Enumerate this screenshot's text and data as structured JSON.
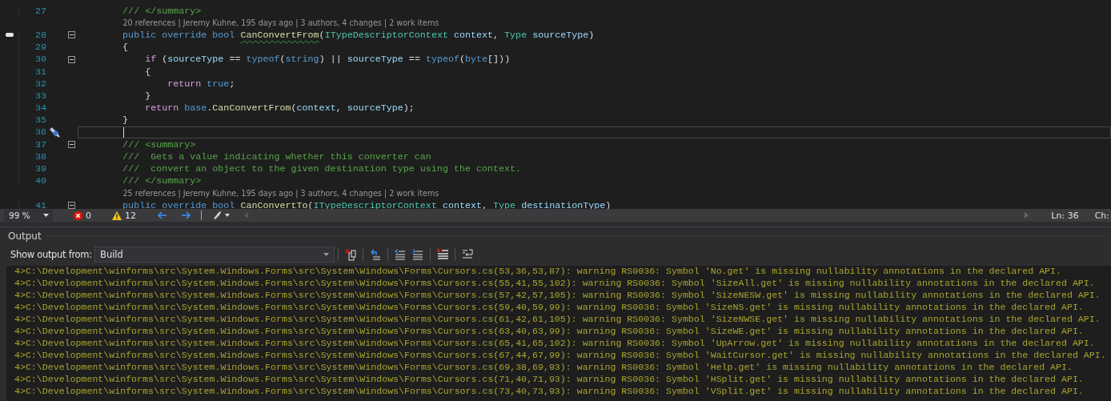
{
  "editor": {
    "lines": [
      {
        "kind": "code",
        "number": "27",
        "fold": false,
        "marker": false,
        "current": false,
        "tokens": [
          {
            "kind": "comment",
            "text": "        /// </summary>"
          }
        ]
      },
      {
        "kind": "lens",
        "text": "20 references | Jeremy Kuhne, 195 days ago | 3 authors, 4 changes | 2 work items"
      },
      {
        "kind": "code",
        "number": "28",
        "fold": true,
        "marker": true,
        "current": false,
        "tokens": [
          {
            "kind": "keyword",
            "text": "        public override bool "
          },
          {
            "kind": "method",
            "text": "CanConvertFrom",
            "squiggle": true
          },
          {
            "kind": "plain",
            "text": "("
          },
          {
            "kind": "type",
            "text": "ITypeDescriptorContext "
          },
          {
            "kind": "param",
            "text": "context"
          },
          {
            "kind": "plain",
            "text": ", "
          },
          {
            "kind": "type",
            "text": "Type "
          },
          {
            "kind": "param",
            "text": "sourceType"
          },
          {
            "kind": "plain",
            "text": ")"
          }
        ]
      },
      {
        "kind": "code",
        "number": "29",
        "fold": false,
        "marker": false,
        "current": false,
        "tokens": [
          {
            "kind": "plain",
            "text": "        {"
          }
        ]
      },
      {
        "kind": "code",
        "number": "30",
        "fold": true,
        "marker": false,
        "current": false,
        "tokens": [
          {
            "kind": "control",
            "text": "            if"
          },
          {
            "kind": "plain",
            "text": " ("
          },
          {
            "kind": "param",
            "text": "sourceType"
          },
          {
            "kind": "plain",
            "text": " == "
          },
          {
            "kind": "keyword",
            "text": "typeof"
          },
          {
            "kind": "plain",
            "text": "("
          },
          {
            "kind": "keyword",
            "text": "string"
          },
          {
            "kind": "plain",
            "text": ") || "
          },
          {
            "kind": "param",
            "text": "sourceType"
          },
          {
            "kind": "plain",
            "text": " == "
          },
          {
            "kind": "keyword",
            "text": "typeof"
          },
          {
            "kind": "plain",
            "text": "("
          },
          {
            "kind": "keyword",
            "text": "byte"
          },
          {
            "kind": "plain",
            "text": "[]))"
          }
        ]
      },
      {
        "kind": "code",
        "number": "31",
        "fold": false,
        "marker": false,
        "current": false,
        "tokens": [
          {
            "kind": "plain",
            "text": "            {"
          }
        ]
      },
      {
        "kind": "code",
        "number": "32",
        "fold": false,
        "marker": false,
        "current": false,
        "tokens": [
          {
            "kind": "control",
            "text": "                return "
          },
          {
            "kind": "keyword",
            "text": "true"
          },
          {
            "kind": "plain",
            "text": ";"
          }
        ]
      },
      {
        "kind": "code",
        "number": "33",
        "fold": false,
        "marker": false,
        "current": false,
        "tokens": [
          {
            "kind": "plain",
            "text": "            }"
          }
        ]
      },
      {
        "kind": "code",
        "number": "34",
        "fold": false,
        "marker": false,
        "current": false,
        "tokens": [
          {
            "kind": "control",
            "text": "            return "
          },
          {
            "kind": "keyword",
            "text": "base"
          },
          {
            "kind": "plain",
            "text": "."
          },
          {
            "kind": "method",
            "text": "CanConvertFrom"
          },
          {
            "kind": "plain",
            "text": "("
          },
          {
            "kind": "param",
            "text": "context"
          },
          {
            "kind": "plain",
            "text": ", "
          },
          {
            "kind": "param",
            "text": "sourceType"
          },
          {
            "kind": "plain",
            "text": ");"
          }
        ]
      },
      {
        "kind": "code",
        "number": "35",
        "fold": false,
        "marker": false,
        "current": false,
        "tokens": [
          {
            "kind": "plain",
            "text": "        }"
          }
        ]
      },
      {
        "kind": "code",
        "number": "36",
        "fold": false,
        "marker": false,
        "current": true
      },
      {
        "kind": "code",
        "number": "37",
        "fold": true,
        "marker": false,
        "current": false,
        "tokens": [
          {
            "kind": "comment",
            "text": "        /// <summary>"
          }
        ]
      },
      {
        "kind": "code",
        "number": "38",
        "fold": false,
        "marker": false,
        "current": false,
        "tokens": [
          {
            "kind": "comment",
            "text": "        ///  Gets a value indicating whether this converter can"
          }
        ]
      },
      {
        "kind": "code",
        "number": "39",
        "fold": false,
        "marker": false,
        "current": false,
        "tokens": [
          {
            "kind": "comment",
            "text": "        ///  convert an object to the given destination type using the context."
          }
        ]
      },
      {
        "kind": "code",
        "number": "40",
        "fold": false,
        "marker": false,
        "current": false,
        "tokens": [
          {
            "kind": "comment",
            "text": "        /// </summary>"
          }
        ]
      },
      {
        "kind": "lens",
        "text": "25 references | Jeremy Kuhne, 195 days ago | 3 authors, 4 changes | 2 work items"
      },
      {
        "kind": "code",
        "number": "41",
        "fold": true,
        "marker": false,
        "current": false,
        "tokens": [
          {
            "kind": "keyword",
            "text": "        public override bool "
          },
          {
            "kind": "method",
            "text": "CanConvertTo"
          },
          {
            "kind": "plain",
            "text": "("
          },
          {
            "kind": "type",
            "text": "ITypeDescriptorContext "
          },
          {
            "kind": "param",
            "text": "context"
          },
          {
            "kind": "plain",
            "text": ", "
          },
          {
            "kind": "type",
            "text": "Type "
          },
          {
            "kind": "param",
            "text": "destinationType"
          },
          {
            "kind": "plain",
            "text": ")"
          }
        ]
      }
    ]
  },
  "status_bar": {
    "zoom": "99 %",
    "errors": "0",
    "warnings": "12",
    "line": "Ln: 36",
    "column": "Ch:"
  },
  "output": {
    "title": "Output",
    "show_from_label": "Show output from:",
    "source": "Build",
    "lines": [
      "4>C:\\Development\\winforms\\src\\System.Windows.Forms\\src\\System\\Windows\\Forms\\Cursors.cs(53,36,53,87): warning RS0036: Symbol 'No.get' is missing nullability annotations in the declared API.",
      "4>C:\\Development\\winforms\\src\\System.Windows.Forms\\src\\System\\Windows\\Forms\\Cursors.cs(55,41,55,102): warning RS0036: Symbol 'SizeAll.get' is missing nullability annotations in the declared API.",
      "4>C:\\Development\\winforms\\src\\System.Windows.Forms\\src\\System\\Windows\\Forms\\Cursors.cs(57,42,57,105): warning RS0036: Symbol 'SizeNESW.get' is missing nullability annotations in the declared API.",
      "4>C:\\Development\\winforms\\src\\System.Windows.Forms\\src\\System\\Windows\\Forms\\Cursors.cs(59,40,59,99): warning RS0036: Symbol 'SizeNS.get' is missing nullability annotations in the declared API.",
      "4>C:\\Development\\winforms\\src\\System.Windows.Forms\\src\\System\\Windows\\Forms\\Cursors.cs(61,42,61,105): warning RS0036: Symbol 'SizeNWSE.get' is missing nullability annotations in the declared API.",
      "4>C:\\Development\\winforms\\src\\System.Windows.Forms\\src\\System\\Windows\\Forms\\Cursors.cs(63,40,63,99): warning RS0036: Symbol 'SizeWE.get' is missing nullability annotations in the declared API.",
      "4>C:\\Development\\winforms\\src\\System.Windows.Forms\\src\\System\\Windows\\Forms\\Cursors.cs(65,41,65,102): warning RS0036: Symbol 'UpArrow.get' is missing nullability annotations in the declared API.",
      "4>C:\\Development\\winforms\\src\\System.Windows.Forms\\src\\System\\Windows\\Forms\\Cursors.cs(67,44,67,99): warning RS0036: Symbol 'WaitCursor.get' is missing nullability annotations in the declared API.",
      "4>C:\\Development\\winforms\\src\\System.Windows.Forms\\src\\System\\Windows\\Forms\\Cursors.cs(69,38,69,93): warning RS0036: Symbol 'Help.get' is missing nullability annotations in the declared API.",
      "4>C:\\Development\\winforms\\src\\System.Windows.Forms\\src\\System\\Windows\\Forms\\Cursors.cs(71,40,71,93): warning RS0036: Symbol 'HSplit.get' is missing nullability annotations in the declared API.",
      "4>C:\\Development\\winforms\\src\\System.Windows.Forms\\src\\System\\Windows\\Forms\\Cursors.cs(73,40,73,93): warning RS0036: Symbol 'VSplit.get' is missing nullability annotations in the declared API."
    ]
  }
}
